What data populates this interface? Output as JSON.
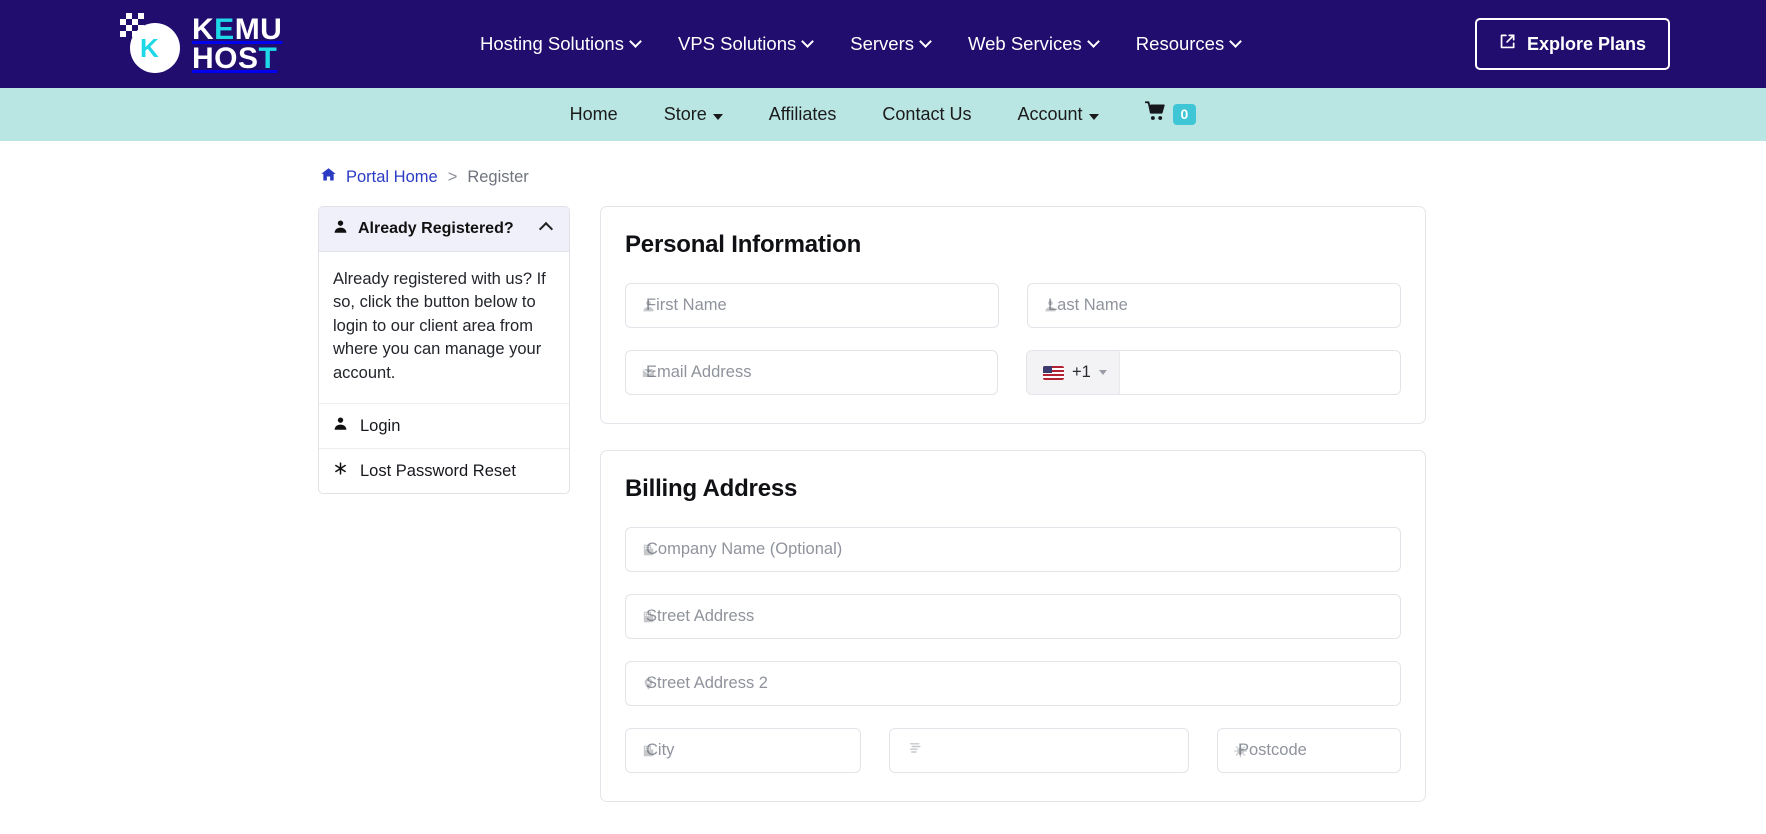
{
  "brand": {
    "logo_line1": "KEMU",
    "logo_line1_accent": "E",
    "logo_line2": "HOST",
    "logo_mark_letter": "K"
  },
  "topnav": {
    "items": [
      {
        "label": "Hosting Solutions",
        "icon": "chevron-down-icon",
        "has_dropdown": true
      },
      {
        "label": "VPS Solutions",
        "icon": "chevron-down-icon",
        "has_dropdown": true
      },
      {
        "label": "Servers",
        "icon": "chevron-down-icon",
        "has_dropdown": true
      },
      {
        "label": "Web Services",
        "icon": "chevron-down-icon",
        "has_dropdown": true
      },
      {
        "label": "Resources",
        "icon": "chevron-down-icon",
        "has_dropdown": true
      }
    ],
    "cta": {
      "label": "Explore Plans",
      "icon": "external-link-icon"
    },
    "background_color": "#200d6e"
  },
  "subnav": {
    "background_color": "#b9e5e3",
    "items": [
      {
        "label": "Home",
        "has_dropdown": false
      },
      {
        "label": "Store",
        "has_dropdown": true
      },
      {
        "label": "Affiliates",
        "has_dropdown": false
      },
      {
        "label": "Contact Us",
        "has_dropdown": false
      },
      {
        "label": "Account",
        "has_dropdown": true
      }
    ],
    "cart": {
      "icon": "shopping-cart-icon",
      "count": "0",
      "badge_color": "#3ec6d6"
    }
  },
  "breadcrumb": {
    "home_icon": "home-icon",
    "home_label": "Portal Home",
    "separator": ">",
    "current": "Register",
    "link_color": "#2b3bc4"
  },
  "sidebar": {
    "header": {
      "icon": "user-icon",
      "title": "Already Registered?",
      "toggle_icon": "chevron-up-icon"
    },
    "body_text": "Already registered with us? If so, click the button below to login to our client area from where you can manage your account.",
    "links": [
      {
        "icon": "user-icon",
        "label": "Login"
      },
      {
        "icon": "asterisk-icon",
        "label": "Lost Password Reset"
      }
    ]
  },
  "personal_information": {
    "title": "Personal Information",
    "fields": [
      {
        "name": "first-name",
        "icon": "user-icon",
        "placeholder": "First Name",
        "value": ""
      },
      {
        "name": "last-name",
        "icon": "user-icon",
        "placeholder": "Last Name",
        "value": ""
      },
      {
        "name": "email-address",
        "icon": "envelope-icon",
        "placeholder": "Email Address",
        "value": ""
      }
    ],
    "phone": {
      "flag": "us-flag-icon",
      "country_code": "+1",
      "caret_icon": "caret-down-icon",
      "placeholder": "",
      "value": ""
    }
  },
  "billing_address": {
    "title": "Billing Address",
    "fields": [
      {
        "name": "company-name",
        "icon": "building-icon",
        "placeholder": "Company Name (Optional)",
        "value": ""
      },
      {
        "name": "street-address",
        "icon": "building-icon",
        "placeholder": "Street Address",
        "value": ""
      },
      {
        "name": "street-address-2",
        "icon": "map-pin-icon",
        "placeholder": "Street Address 2",
        "value": ""
      },
      {
        "name": "city",
        "icon": "building-icon",
        "placeholder": "City",
        "value": ""
      },
      {
        "name": "state",
        "icon": "road-sign-icon",
        "placeholder": "",
        "value": ""
      },
      {
        "name": "postcode",
        "icon": "sun-icon",
        "placeholder": "Postcode",
        "value": ""
      }
    ]
  }
}
